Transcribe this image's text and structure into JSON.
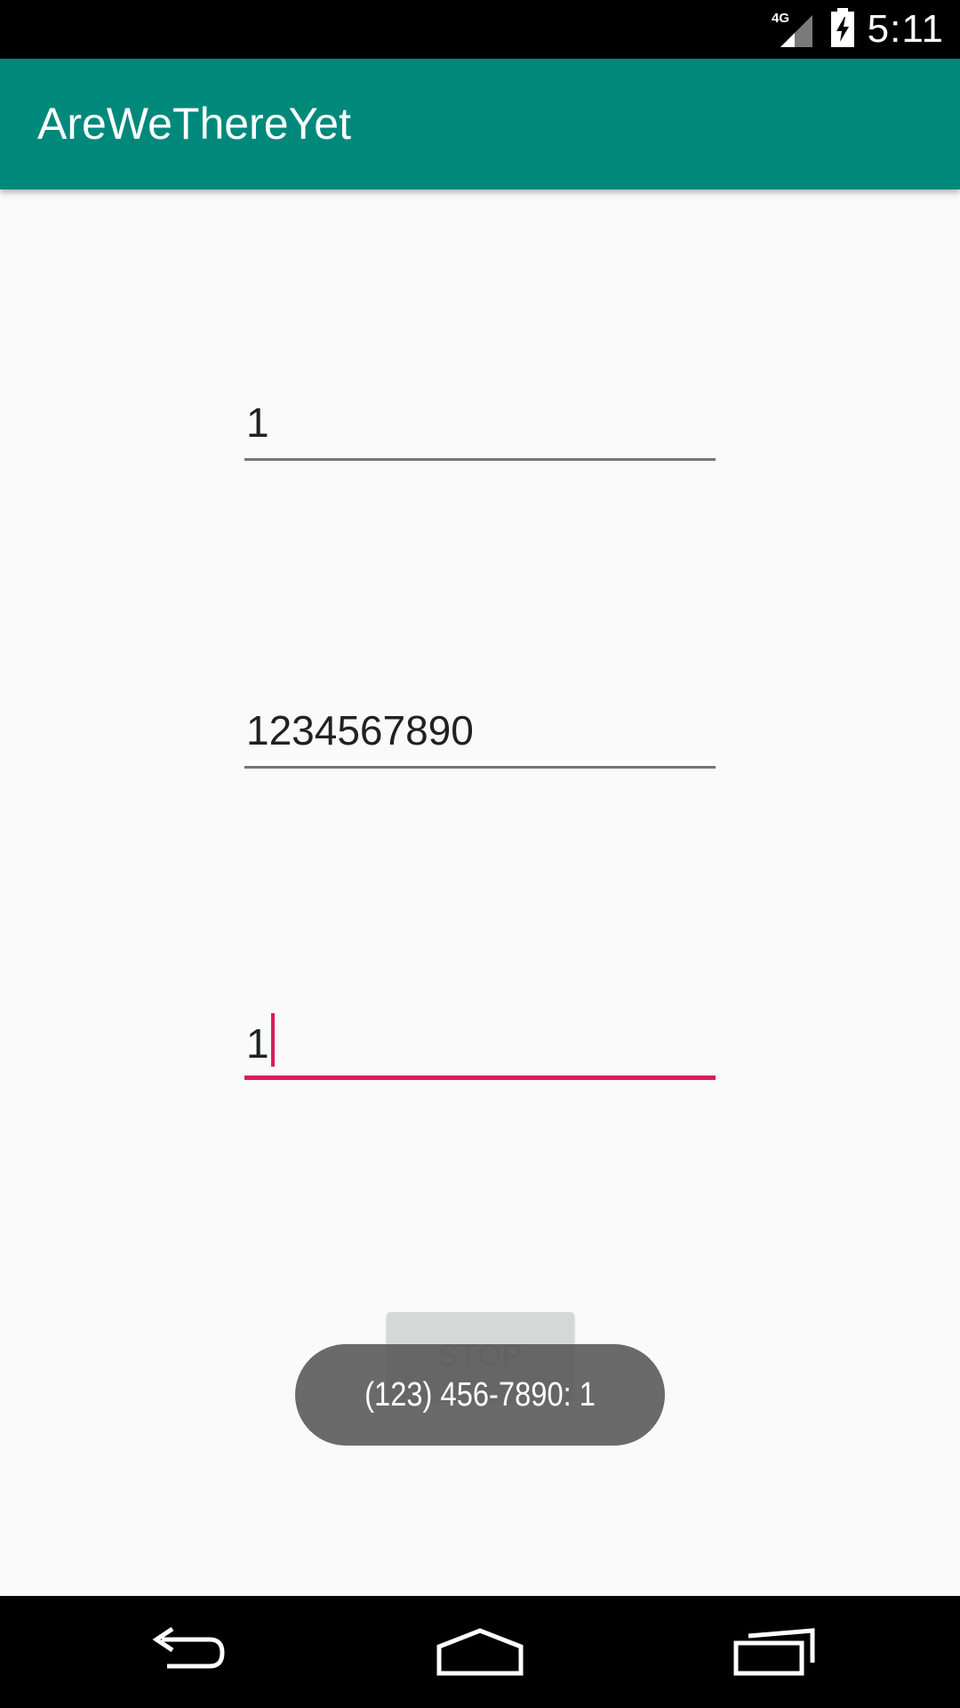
{
  "status_bar": {
    "network_label": "4G",
    "time": "5:11",
    "icons": [
      "network-4g-icon",
      "signal-icon",
      "battery-charging-icon"
    ]
  },
  "app_bar": {
    "title": "AreWeThereYet",
    "color": "#00897b"
  },
  "form": {
    "field_1": {
      "value": "1"
    },
    "field_2": {
      "value": "1234567890"
    },
    "field_3": {
      "value": "1",
      "focused": true
    }
  },
  "stop_button": {
    "label": "STOP"
  },
  "toast": {
    "text": "(123) 456-7890: 1"
  },
  "nav_bar": {
    "icons": [
      "back-icon",
      "home-icon",
      "recents-icon"
    ]
  },
  "colors": {
    "accent": "#d81b60",
    "primary": "#00897b",
    "background": "#fafafa"
  }
}
